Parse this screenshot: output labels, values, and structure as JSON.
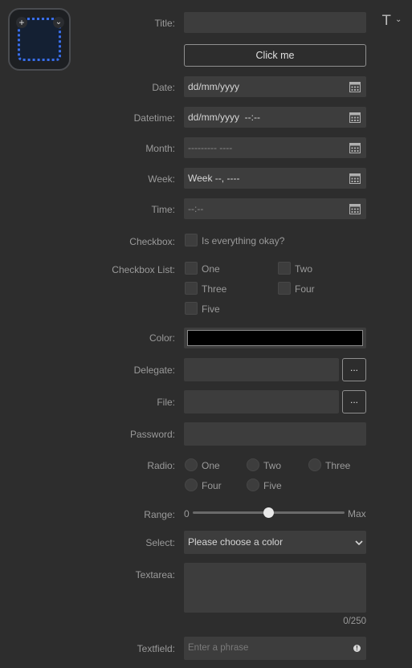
{
  "header": {
    "text_tool_icon": "T",
    "text_tool_chevron": "⌄"
  },
  "thumbnail": {
    "plus": "+",
    "chevron": "⌄"
  },
  "form": {
    "title": {
      "label": "Title:",
      "value": ""
    },
    "button": {
      "label": "Click me"
    },
    "date": {
      "label": "Date:",
      "value": "dd/mm/yyyy"
    },
    "datetime": {
      "label": "Datetime:",
      "value": "dd/mm/yyyy  --:--"
    },
    "month": {
      "label": "Month:",
      "value": "--------- ----"
    },
    "week": {
      "label": "Week:",
      "value": "Week --, ----"
    },
    "time": {
      "label": "Time:",
      "value": "--:--"
    },
    "checkbox": {
      "label": "Checkbox:",
      "text": "Is everything okay?"
    },
    "checkbox_list": {
      "label": "Checkbox List:",
      "options": [
        "One",
        "Two",
        "Three",
        "Four",
        "Five"
      ]
    },
    "color": {
      "label": "Color:",
      "value": "#000000"
    },
    "delegate": {
      "label": "Delegate:",
      "button": "..."
    },
    "file": {
      "label": "File:",
      "button": "..."
    },
    "password": {
      "label": "Password:",
      "value": ""
    },
    "radio": {
      "label": "Radio:",
      "options": [
        "One",
        "Two",
        "Three",
        "Four",
        "Five"
      ]
    },
    "range": {
      "label": "Range:",
      "min_label": "0",
      "max_label": "Max",
      "value_fraction": 0.5
    },
    "select": {
      "label": "Select:",
      "value": "Please choose a color"
    },
    "textarea": {
      "label": "Textarea:",
      "counter": "0/250"
    },
    "textfield": {
      "label": "Textfield:",
      "placeholder": "Enter a phrase",
      "info": "!"
    }
  }
}
